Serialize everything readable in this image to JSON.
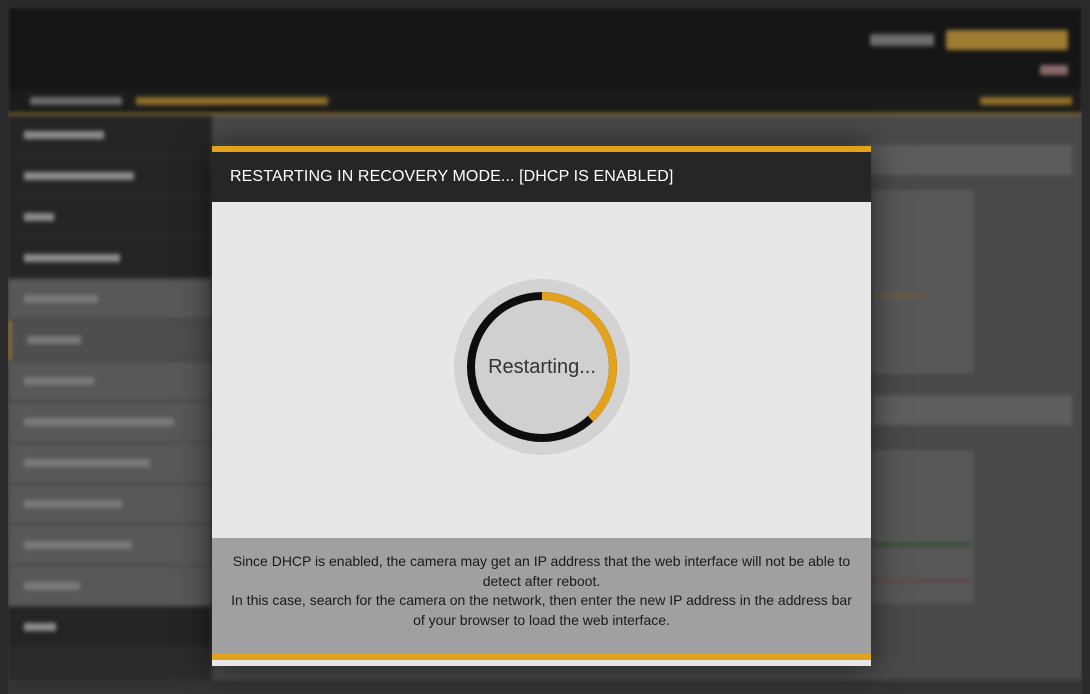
{
  "modal": {
    "title": "RESTARTING IN RECOVERY MODE... [DHCP IS ENABLED]",
    "spinner_text": "Restarting...",
    "progress_fraction": 0.38,
    "message_line1": "Since DHCP is enabled, the camera may get an IP address that the web interface will not be able to detect after reboot.",
    "message_line2": "In this case, search for the camera on the network, then enter the new IP address in the address bar of your browser to load the web interface."
  },
  "colors": {
    "accent": "#e3a21c",
    "header_bg": "#262626",
    "body_bg": "#e7e7e7",
    "footer_bg": "#a0a0a0",
    "spinner_track": "#0d0d0d",
    "spinner_outer_ring": "#d3d3d3"
  },
  "icons": {
    "spinner": "progress-ring-icon"
  }
}
